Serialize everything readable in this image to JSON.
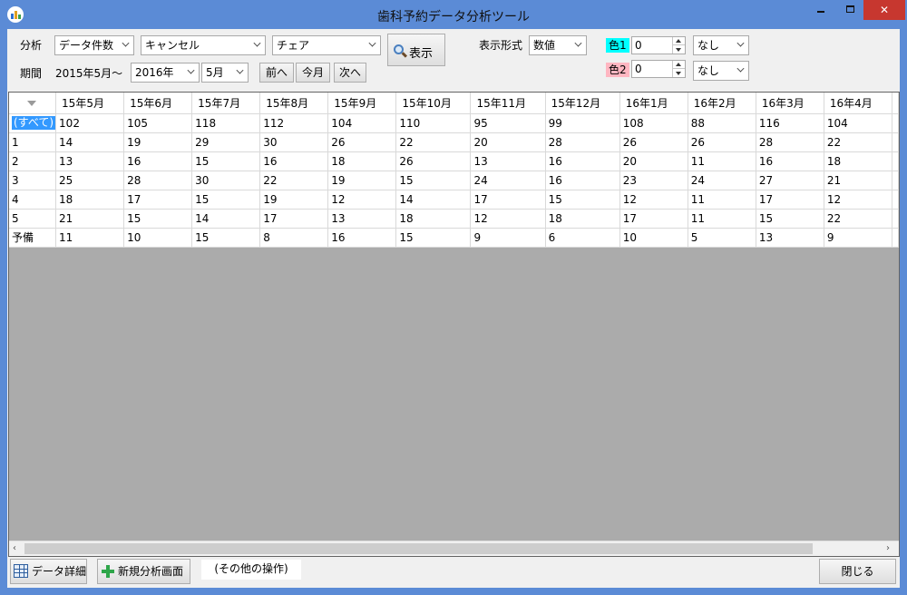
{
  "window": {
    "title": "歯科予約データ分析ツール",
    "close_glyph": "✕"
  },
  "controls": {
    "analysis_label": "分析",
    "analysis_type": "データ件数",
    "analysis_filter": "キャンセル",
    "analysis_group": "チェア",
    "show_button": "表示",
    "period_label": "期間",
    "period_start": "2015年5月～",
    "period_year": "2016年",
    "period_month": "5月",
    "prev_button": "前へ",
    "this_month_button": "今月",
    "next_button": "次へ",
    "display_format_label": "表示形式",
    "display_format": "数値",
    "color1_label": "色1",
    "color1_value": "0",
    "color1_option": "なし",
    "color2_label": "色2",
    "color2_value": "0",
    "color2_option": "なし"
  },
  "colors": {
    "color1_bg": "#00ffff",
    "color2_bg": "#ffb6c1",
    "title_bar": "#5b8bd6",
    "selection": "#3399ff"
  },
  "table": {
    "columns": [
      "15年5月",
      "15年6月",
      "15年7月",
      "15年8月",
      "15年9月",
      "15年10月",
      "15年11月",
      "15年12月",
      "16年1月",
      "16年2月",
      "16年3月",
      "16年4月"
    ],
    "rows": [
      {
        "label": "(すべて)",
        "values": [
          "102",
          "105",
          "118",
          "112",
          "104",
          "110",
          "95",
          "99",
          "108",
          "88",
          "116",
          "104"
        ]
      },
      {
        "label": "1",
        "values": [
          "14",
          "19",
          "29",
          "30",
          "26",
          "22",
          "20",
          "28",
          "26",
          "26",
          "28",
          "22"
        ]
      },
      {
        "label": "2",
        "values": [
          "13",
          "16",
          "15",
          "16",
          "18",
          "26",
          "13",
          "16",
          "20",
          "11",
          "16",
          "18"
        ]
      },
      {
        "label": "3",
        "values": [
          "25",
          "28",
          "30",
          "22",
          "19",
          "15",
          "24",
          "16",
          "23",
          "24",
          "27",
          "21"
        ]
      },
      {
        "label": "4",
        "values": [
          "18",
          "17",
          "15",
          "19",
          "12",
          "14",
          "17",
          "15",
          "12",
          "11",
          "17",
          "12"
        ]
      },
      {
        "label": "5",
        "values": [
          "21",
          "15",
          "14",
          "17",
          "13",
          "18",
          "12",
          "18",
          "17",
          "11",
          "15",
          "22"
        ]
      },
      {
        "label": "予備",
        "values": [
          "11",
          "10",
          "15",
          "8",
          "16",
          "15",
          "9",
          "6",
          "10",
          "5",
          "13",
          "9"
        ]
      }
    ]
  },
  "footer": {
    "data_detail_button": "データ詳細",
    "new_analysis_button": "新規分析画面",
    "other_ops": "(その他の操作)",
    "close_button": "閉じる"
  }
}
